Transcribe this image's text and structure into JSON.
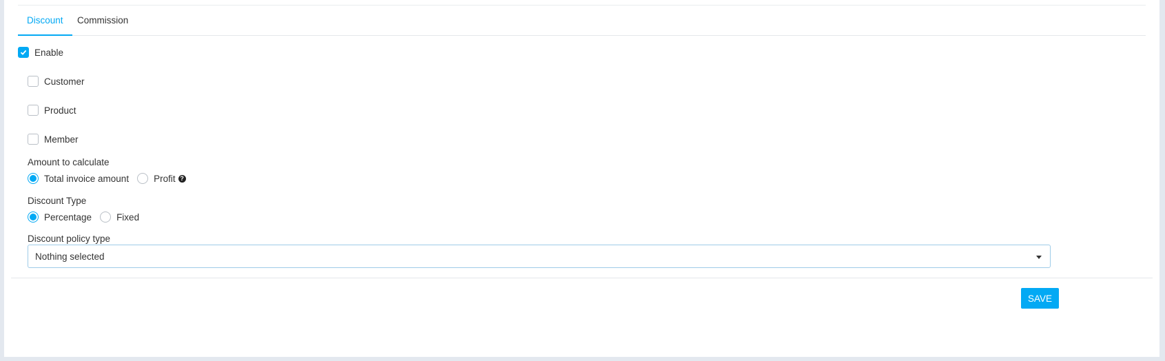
{
  "tabs": [
    {
      "label": "Discount",
      "active": true
    },
    {
      "label": "Commission",
      "active": false
    }
  ],
  "enable": {
    "label": "Enable",
    "checked": true
  },
  "targets": [
    {
      "label": "Customer",
      "checked": false
    },
    {
      "label": "Product",
      "checked": false
    },
    {
      "label": "Member",
      "checked": false
    }
  ],
  "amount_to_calculate": {
    "title": "Amount to calculate",
    "options": [
      {
        "label": "Total invoice amount",
        "selected": true
      },
      {
        "label": "Profit",
        "selected": false
      }
    ],
    "help_icon": "question-circle-icon"
  },
  "discount_type": {
    "title": "Discount Type",
    "options": [
      {
        "label": "Percentage",
        "selected": true
      },
      {
        "label": "Fixed",
        "selected": false
      }
    ]
  },
  "policy_type": {
    "title": "Discount policy type",
    "value": "Nothing selected"
  },
  "save_label": "SAVE",
  "colors": {
    "accent": "#03a9f4",
    "background": "#e3e8ef"
  }
}
